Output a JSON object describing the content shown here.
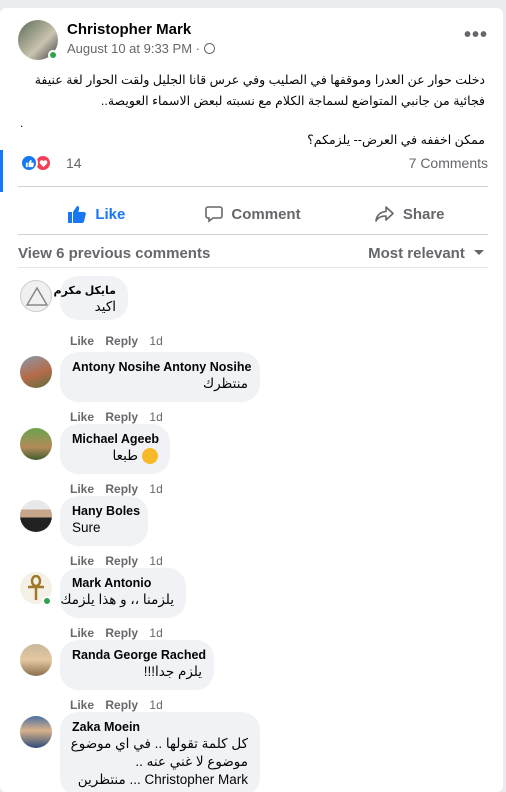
{
  "post": {
    "author": "Christopher Mark",
    "date": "August 10 at 9:33 PM",
    "separator": " · ",
    "more_glyph": "•••",
    "text": "دخلت حوار عن العدرا وموقفها في الصليب وفي عرس قانا الجليل ولقت الحوار لغة عنيفة فجائية من جانبي المتواضع لسماجة الكلام مع نسبته لبعض الاسماء العويصة..",
    "dot": ".",
    "question": "ممكن اخففه في العرض-- يلزمكم؟",
    "reaction_count": "14",
    "comments_count": "7 Comments"
  },
  "actions": {
    "like": "Like",
    "comment": "Comment",
    "share": "Share"
  },
  "comments_header": {
    "view_previous": "View 6 previous comments",
    "sort": "Most relevant"
  },
  "comment_actions": {
    "like": "Like",
    "reply": "Reply",
    "time": "1d"
  },
  "comments": [
    {
      "name": "مايكل مكرم",
      "text": "اكيد"
    },
    {
      "name": "Antony Nosihe Antony Nosihe",
      "text": "منتظرك"
    },
    {
      "name": "Michael Ageeb",
      "text": "طبعا"
    },
    {
      "name": "Hany Boles",
      "text": "Sure"
    },
    {
      "name": "Mark Antonio",
      "text": "يلزمنا ،، و هذا يلزمك"
    },
    {
      "name": "Randa George Rached",
      "text": "يلزم جدا!!!"
    },
    {
      "name": "Zaka Moein",
      "line1": "كل كلمة تقولها .. في اي موضوع",
      "line2": "موضوع لا غني عنه ..",
      "line3": "Christopher Mark ... منتظرين"
    }
  ],
  "colors": {
    "accent": "#1877f2",
    "muted": "#65676b",
    "bubble": "#f0f2f5",
    "online": "#31a24c",
    "love": "#f33e58"
  }
}
